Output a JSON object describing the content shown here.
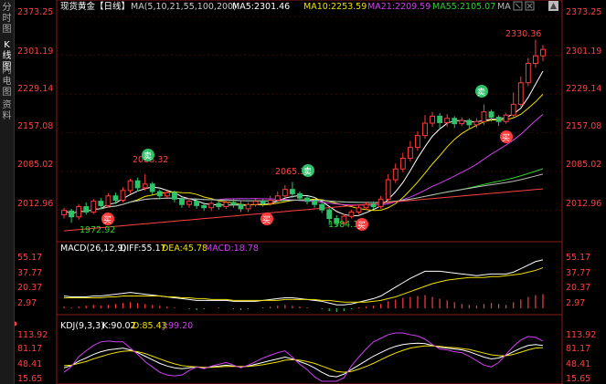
{
  "sidebar": {
    "items": [
      {
        "label": "分时图",
        "active": false
      },
      {
        "label": "K线图",
        "active": true
      },
      {
        "label": "闪电图",
        "active": false
      },
      {
        "label": "资料",
        "active": false
      }
    ]
  },
  "main": {
    "title": "现货黄金【日线】",
    "ma_legend": "MA(5,10,21,55,100,200)",
    "ma5": "MA5:2301.46",
    "ma10": "MA10:2253.59",
    "ma21": "MA21:2209.59",
    "ma55": "MA55:2105.07",
    "ma_more": "MA",
    "y_ticks": [
      "2373.25",
      "2301.19",
      "2229.14",
      "2157.08",
      "2085.02",
      "2012.96"
    ],
    "annotations": {
      "hi": "2330.36",
      "mid": "2065.3",
      "low1": "1972.92",
      "low2": "1984.1",
      "top1": "2088.32"
    },
    "signals": {
      "buy": "买",
      "sell": "卖"
    }
  },
  "macd": {
    "title": "MACD(26,12,9)",
    "diff": "DIFF:55.17",
    "dea": "DEA:45.78",
    "macd": "MACD:18.78",
    "y_ticks": [
      "55.17",
      "37.77",
      "20.37",
      "2.97"
    ]
  },
  "kdj": {
    "title": "KDJ(9,3,3)",
    "k": "K:90.02",
    "d": "D:85.43",
    "j": "J:99.20",
    "y_ticks": [
      "113.92",
      "81.17",
      "48.41",
      "15.65"
    ]
  },
  "colors": {
    "up": "#ff3b3b",
    "down": "#2ec26a",
    "ma5": "#ffffff",
    "ma10": "#f0e000",
    "ma21": "#d040f0",
    "ma55": "#30d030",
    "ma100": "#bbbbbb",
    "ma200": "#ff4040"
  },
  "chart_data": {
    "type": "candlestick",
    "main_ylim": [
      1960,
      2380
    ],
    "candles": [
      [
        2005,
        2013,
        1998,
        2018
      ],
      [
        2012,
        2001,
        1990,
        2016
      ],
      [
        2001,
        2020,
        1996,
        2025
      ],
      [
        2020,
        2010,
        2005,
        2028
      ],
      [
        2010,
        2030,
        2006,
        2034
      ],
      [
        2030,
        2022,
        2016,
        2036
      ],
      [
        2022,
        2040,
        2018,
        2045
      ],
      [
        2040,
        2032,
        2025,
        2046
      ],
      [
        2032,
        2050,
        2028,
        2056
      ],
      [
        2050,
        2068,
        2044,
        2072
      ],
      [
        2068,
        2055,
        2048,
        2074
      ],
      [
        2055,
        2062,
        2050,
        2080
      ],
      [
        2062,
        2048,
        2042,
        2066
      ],
      [
        2048,
        2040,
        2034,
        2052
      ],
      [
        2040,
        2046,
        2036,
        2050
      ],
      [
        2046,
        2034,
        2028,
        2050
      ],
      [
        2034,
        2024,
        2018,
        2038
      ],
      [
        2024,
        2030,
        2018,
        2036
      ],
      [
        2030,
        2022,
        2016,
        2034
      ],
      [
        2022,
        2018,
        2012,
        2028
      ],
      [
        2018,
        2026,
        2012,
        2030
      ],
      [
        2026,
        2020,
        2014,
        2032
      ],
      [
        2020,
        2028,
        2016,
        2034
      ],
      [
        2028,
        2024,
        2018,
        2034
      ],
      [
        2024,
        2016,
        2010,
        2030
      ],
      [
        2016,
        2024,
        2010,
        2028
      ],
      [
        2024,
        2030,
        2020,
        2036
      ],
      [
        2030,
        2026,
        2020,
        2034
      ],
      [
        2026,
        2032,
        2022,
        2040
      ],
      [
        2032,
        2040,
        2028,
        2048
      ],
      [
        2040,
        2052,
        2036,
        2060
      ],
      [
        2052,
        2044,
        2036,
        2066
      ],
      [
        2044,
        2036,
        2030,
        2048
      ],
      [
        2036,
        2030,
        2024,
        2040
      ],
      [
        2030,
        2024,
        2018,
        2034
      ],
      [
        2024,
        2014,
        2008,
        2028
      ],
      [
        2014,
        1998,
        1986,
        2018
      ],
      [
        1998,
        1990,
        1984,
        2004
      ],
      [
        1990,
        2002,
        1986,
        2006
      ],
      [
        2002,
        2010,
        1998,
        2014
      ],
      [
        2010,
        2018,
        2006,
        2022
      ],
      [
        2018,
        2024,
        2014,
        2028
      ],
      [
        2024,
        2020,
        2016,
        2030
      ],
      [
        2020,
        2034,
        2016,
        2040
      ],
      [
        2034,
        2070,
        2030,
        2080
      ],
      [
        2070,
        2090,
        2064,
        2100
      ],
      [
        2090,
        2110,
        2084,
        2120
      ],
      [
        2110,
        2130,
        2104,
        2142
      ],
      [
        2130,
        2152,
        2124,
        2160
      ],
      [
        2152,
        2175,
        2146,
        2190
      ],
      [
        2175,
        2188,
        2168,
        2196
      ],
      [
        2188,
        2176,
        2164,
        2194
      ],
      [
        2176,
        2184,
        2168,
        2192
      ],
      [
        2184,
        2174,
        2166,
        2188
      ],
      [
        2174,
        2180,
        2170,
        2186
      ],
      [
        2180,
        2172,
        2164,
        2184
      ],
      [
        2172,
        2178,
        2166,
        2184
      ],
      [
        2178,
        2196,
        2172,
        2210
      ],
      [
        2196,
        2186,
        2178,
        2200
      ],
      [
        2186,
        2178,
        2170,
        2190
      ],
      [
        2178,
        2190,
        2174,
        2194
      ],
      [
        2190,
        2210,
        2184,
        2232
      ],
      [
        2210,
        2250,
        2206,
        2262
      ],
      [
        2250,
        2286,
        2244,
        2296
      ],
      [
        2286,
        2300,
        2278,
        2330
      ],
      [
        2300,
        2312,
        2290,
        2320
      ]
    ],
    "macd_ylim": [
      -2,
      60
    ],
    "macd_hist": [
      2,
      1,
      2,
      3,
      4,
      3,
      4,
      5,
      6,
      7,
      6,
      5,
      4,
      3,
      2,
      1,
      0,
      -1,
      -2,
      -1,
      0,
      1,
      0,
      -1,
      -2,
      -1,
      0,
      1,
      2,
      3,
      4,
      3,
      2,
      1,
      0,
      -1,
      -3,
      -4,
      -3,
      -1,
      1,
      2,
      3,
      5,
      8,
      10,
      12,
      13,
      14,
      15,
      13,
      11,
      9,
      7,
      5,
      4,
      3,
      5,
      6,
      5,
      4,
      7,
      10,
      13,
      15,
      16
    ],
    "macd_diff": [
      14,
      13,
      13,
      13,
      14,
      14,
      15,
      16,
      17,
      18,
      17,
      16,
      15,
      14,
      13,
      12,
      11,
      10,
      9,
      9,
      9,
      9,
      9,
      8,
      8,
      8,
      8,
      9,
      10,
      11,
      12,
      12,
      11,
      10,
      9,
      8,
      6,
      4,
      4,
      5,
      7,
      9,
      11,
      14,
      19,
      24,
      29,
      34,
      38,
      42,
      42,
      42,
      41,
      40,
      39,
      38,
      37,
      38,
      39,
      39,
      39,
      41,
      45,
      49,
      53,
      55
    ],
    "macd_dea": [
      12,
      12,
      12,
      12,
      12,
      12,
      13,
      13,
      14,
      14,
      14,
      14,
      14,
      14,
      13,
      13,
      12,
      12,
      11,
      11,
      10,
      10,
      10,
      9,
      9,
      9,
      9,
      9,
      9,
      9,
      10,
      10,
      10,
      10,
      10,
      9,
      9,
      8,
      7,
      7,
      7,
      7,
      8,
      9,
      11,
      13,
      16,
      19,
      22,
      25,
      28,
      30,
      32,
      33,
      34,
      35,
      35,
      35,
      36,
      36,
      37,
      38,
      39,
      41,
      43,
      46
    ],
    "kdj_ylim": [
      10,
      120
    ],
    "kdj_k": [
      40,
      45,
      55,
      62,
      70,
      76,
      80,
      82,
      84,
      80,
      74,
      66,
      58,
      50,
      44,
      40,
      38,
      40,
      42,
      40,
      42,
      44,
      46,
      44,
      42,
      44,
      48,
      52,
      56,
      60,
      64,
      60,
      54,
      48,
      40,
      30,
      22,
      20,
      26,
      36,
      46,
      56,
      66,
      74,
      82,
      88,
      92,
      94,
      95,
      94,
      90,
      86,
      84,
      82,
      80,
      76,
      70,
      64,
      60,
      62,
      68,
      76,
      84,
      90,
      92,
      90
    ],
    "kdj_d": [
      45,
      46,
      50,
      54,
      60,
      65,
      70,
      74,
      77,
      78,
      76,
      72,
      66,
      60,
      54,
      49,
      45,
      43,
      42,
      41,
      41,
      42,
      43,
      43,
      43,
      43,
      45,
      47,
      50,
      53,
      57,
      58,
      57,
      54,
      50,
      44,
      38,
      32,
      30,
      32,
      37,
      43,
      50,
      58,
      66,
      73,
      79,
      84,
      87,
      89,
      89,
      88,
      86,
      85,
      83,
      81,
      77,
      73,
      69,
      67,
      67,
      70,
      75,
      80,
      84,
      85
    ],
    "kdj_j": [
      30,
      43,
      65,
      78,
      90,
      98,
      100,
      98,
      98,
      84,
      70,
      54,
      42,
      30,
      24,
      22,
      24,
      34,
      42,
      38,
      44,
      48,
      52,
      46,
      40,
      46,
      54,
      62,
      68,
      74,
      78,
      64,
      48,
      36,
      20,
      2,
      -10,
      -4,
      18,
      44,
      64,
      82,
      98,
      106,
      114,
      118,
      118,
      114,
      111,
      104,
      92,
      82,
      80,
      76,
      74,
      66,
      56,
      46,
      42,
      52,
      70,
      88,
      102,
      110,
      108,
      100
    ]
  }
}
